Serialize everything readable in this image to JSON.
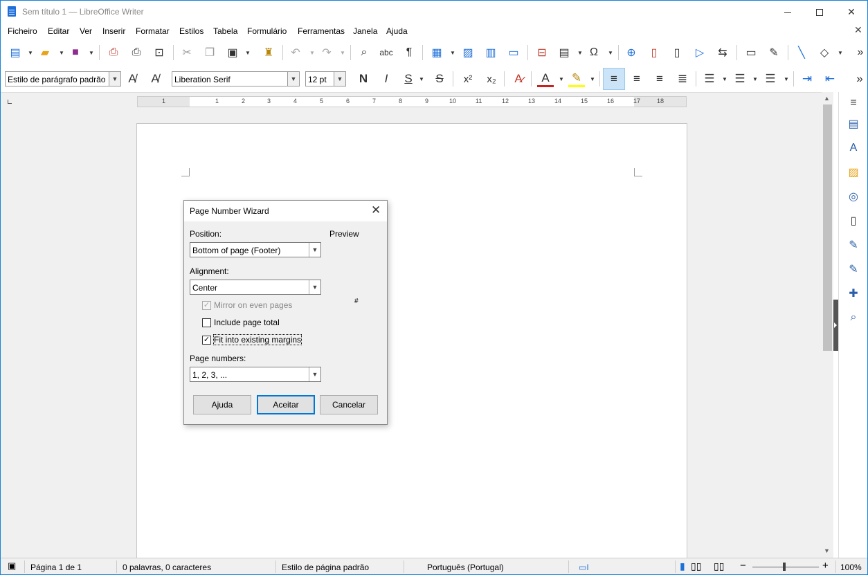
{
  "window": {
    "title": "Sem título 1 — LibreOffice Writer"
  },
  "menubar": {
    "items": [
      "Ficheiro",
      "Editar",
      "Ver",
      "Inserir",
      "Formatar",
      "Estilos",
      "Tabela",
      "Formulário",
      "Ferramentas",
      "Janela",
      "Ajuda"
    ]
  },
  "formatting": {
    "paragraph_style": "Estilo de parágrafo padrão",
    "font_name": "Liberation Serif",
    "font_size": "12 pt",
    "bold": "N",
    "italic": "I",
    "underline": "S",
    "strike": "S"
  },
  "ruler": {
    "ticks": [
      "1",
      "1",
      "2",
      "3",
      "4",
      "5",
      "6",
      "7",
      "8",
      "9",
      "10",
      "11",
      "12",
      "13",
      "14",
      "15",
      "16",
      "17",
      "18"
    ]
  },
  "dialog": {
    "title": "Page Number Wizard",
    "position_label": "Position:",
    "position_value": "Bottom of page (Footer)",
    "preview_label": "Preview",
    "preview_symbol": "#",
    "alignment_label": "Alignment:",
    "alignment_value": "Center",
    "mirror_label": "Mirror on even pages",
    "mirror_checked": true,
    "mirror_enabled": false,
    "page_total_label": "Include page total",
    "page_total_checked": false,
    "fit_margins_label": "Fit into existing margins",
    "fit_margins_checked": true,
    "page_numbers_label": "Page numbers:",
    "page_numbers_value": "1, 2, 3, ...",
    "help_button": "Ajuda",
    "ok_button": "Aceitar",
    "cancel_button": "Cancelar"
  },
  "statusbar": {
    "page": "Página 1 de 1",
    "words": "0 palavras, 0 caracteres",
    "page_style": "Estilo de página padrão",
    "language": "Português (Portugal)",
    "zoom": "100%"
  },
  "colors": {
    "accent": "#0078d7",
    "window_border": "#1883d7",
    "sidebar_icons": "#2b5fa8"
  }
}
